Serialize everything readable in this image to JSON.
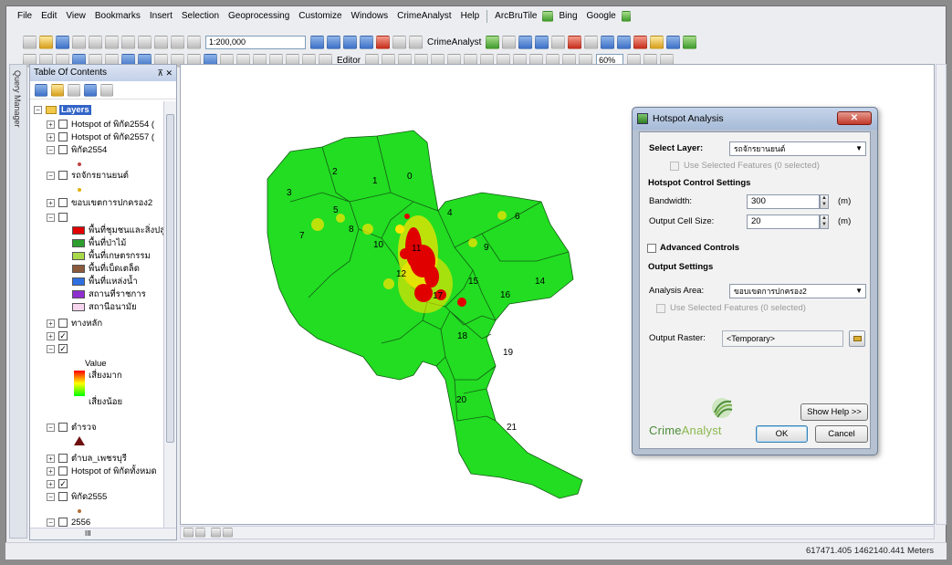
{
  "menubar": {
    "items": [
      "File",
      "Edit",
      "View",
      "Bookmarks",
      "Insert",
      "Selection",
      "Geoprocessing",
      "Customize",
      "Windows",
      "CrimeAnalyst",
      "Help"
    ],
    "extras": [
      "ArcBruTile",
      "Bing",
      "Google"
    ]
  },
  "toolbar": {
    "scale": "1:200,000",
    "crime_analyst": "CrimeAnalyst",
    "editor": "Editor",
    "zoom": "60%"
  },
  "side": {
    "query_manager": "Query Manager"
  },
  "toc": {
    "title": "Table Of Contents",
    "pin": "⊼ ✕",
    "layers": [
      {
        "label": "Layers"
      },
      {
        "label": "Hotspot of พิกัด2554 ("
      },
      {
        "label": "Hotspot of พิกัด2557 ("
      },
      {
        "label": "พิกัด2554"
      },
      {
        "label": "รถจักรยานยนต์"
      },
      {
        "label": "ขอบเขตการปกครอง2"
      },
      {
        "label": "ทางหลัก"
      },
      {
        "label": "Value"
      },
      {
        "label": "เสี่ยงมาก"
      },
      {
        "label": "เสี่ยงน้อย"
      },
      {
        "label": "ตำรวจ"
      },
      {
        "label": "ตำบล_เพชรบุรี"
      },
      {
        "label": "Hotspot of พิกัดทั้งหมด"
      },
      {
        "label": "พิกัด2555"
      },
      {
        "label": "2556"
      }
    ],
    "landuse_legend": [
      {
        "label": "พื้นที่ชุมชนและสิ่งปลูก",
        "color": "#e00000"
      },
      {
        "label": "พื้นที่ป่าไม้",
        "color": "#2e9e2e"
      },
      {
        "label": "พื้นที่เกษตรกรรม",
        "color": "#a8d94a"
      },
      {
        "label": "พื้นที่เบ็ดเตล็ด",
        "color": "#8b5a3c"
      },
      {
        "label": "พื้นที่แหล่งน้ำ",
        "color": "#2f6fe0"
      },
      {
        "label": "สถานที่ราชการ",
        "color": "#8e2fd0"
      },
      {
        "label": "สถานีอนามัย",
        "color": "#f6d6ee"
      }
    ],
    "hscroll_label": "III"
  },
  "map": {
    "zone_labels": [
      "0",
      "1",
      "2",
      "3",
      "4",
      "5",
      "6",
      "7",
      "8",
      "9",
      "10",
      "11",
      "12",
      "14",
      "15",
      "16",
      "17",
      "18",
      "19",
      "20",
      "21"
    ],
    "fill_color": "#22dd22",
    "hotspot_color": "#e00000"
  },
  "status": {
    "coords": "617471.405  1462140.441 Meters"
  },
  "dialog": {
    "title": "Hotspot Analysis",
    "close": "✕",
    "select_layer_label": "Select Layer:",
    "select_layer_value": "รถจักรยานยนต์",
    "use_selected_1": "Use Selected Features (0 selected)",
    "control_header": "Hotspot Control Settings",
    "bandwidth_label": "Bandwidth:",
    "bandwidth_value": "300",
    "bandwidth_unit": "(m)",
    "cellsize_label": "Output Cell Size:",
    "cellsize_value": "20",
    "cellsize_unit": "(m)",
    "advanced_label": "Advanced Controls",
    "output_header": "Output Settings",
    "analysis_area_label": "Analysis Area:",
    "analysis_area_value": "ขอบเขตการปกครอง2",
    "use_selected_2": "Use Selected Features (0 selected)",
    "output_raster_label": "Output Raster:",
    "output_raster_value": "<Temporary>",
    "show_help": "Show Help >>",
    "ok": "OK",
    "cancel": "Cancel",
    "logo_a": "Crime",
    "logo_b": "Analyst"
  }
}
